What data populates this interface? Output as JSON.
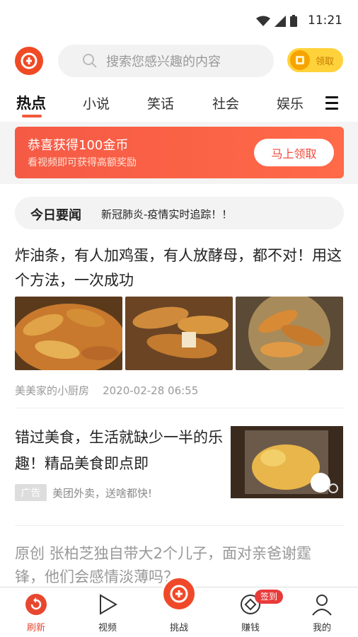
{
  "status_bar": {
    "time": "11:21"
  },
  "header": {
    "search_placeholder": "搜索您感兴趣的内容",
    "reward_label": "领取"
  },
  "tabs": [
    {
      "label": "热点",
      "active": true
    },
    {
      "label": "小说"
    },
    {
      "label": "笑话"
    },
    {
      "label": "社会"
    },
    {
      "label": "娱乐"
    }
  ],
  "banner": {
    "title": "恭喜获得100金币",
    "subtitle": "看视频即可获得高额奖励",
    "button": "马上领取"
  },
  "today_news": {
    "tag": "今日要闻",
    "text": "新冠肺炎-疫情实时追踪！！"
  },
  "feed": [
    {
      "title": "炸油条，有人加鸡蛋，有人放酵母，都不对！用这个方法，一次成功",
      "source": "美美家的小厨房",
      "time": "2020-02-28 06:55"
    },
    {
      "title": "错过美食，生活就缺少一半的乐趣！精品美食即点即",
      "ad_tag": "广告",
      "ad_text": "美团外卖，送啥都快!"
    },
    {
      "title": "原创 张柏芝独自带大2个儿子，面对亲爸谢霆锋，他们会感情淡薄吗？"
    }
  ],
  "bottom_nav": [
    {
      "label": "刷新",
      "icon": "refresh-icon",
      "active": true
    },
    {
      "label": "视频",
      "icon": "play-icon"
    },
    {
      "label": "挑战",
      "icon": "challenge-icon"
    },
    {
      "label": "赚钱",
      "icon": "coin-icon",
      "badge": "签到"
    },
    {
      "label": "我的",
      "icon": "user-icon"
    }
  ],
  "colors": {
    "accent": "#f04a25",
    "gold": "#ffd23b"
  }
}
